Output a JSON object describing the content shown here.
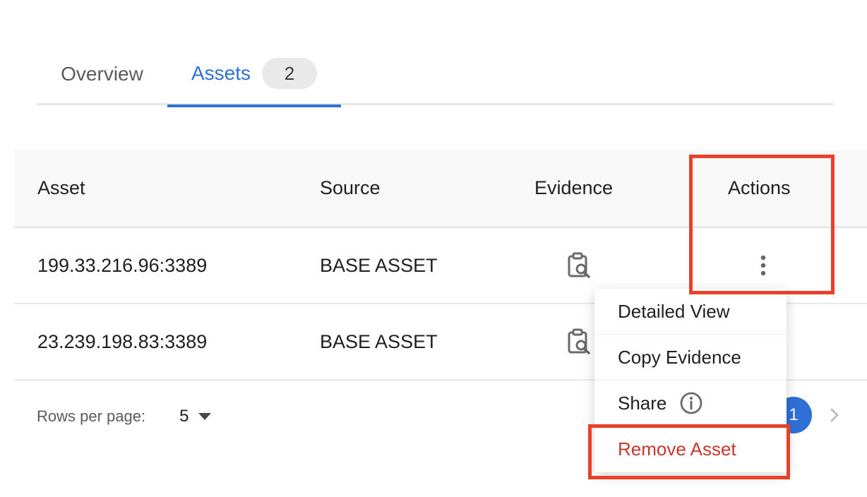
{
  "tabs": [
    {
      "label": "Overview"
    },
    {
      "label": "Assets",
      "count": "2"
    }
  ],
  "table": {
    "headers": {
      "asset": "Asset",
      "source": "Source",
      "evidence": "Evidence",
      "actions": "Actions"
    },
    "rows": [
      {
        "asset": "199.33.216.96:3389",
        "source": "BASE ASSET",
        "evidence_icon": "clipboard-search-icon",
        "actions_icon": "more-vertical-icon"
      },
      {
        "asset": "23.239.198.83:3389",
        "source": "BASE ASSET",
        "evidence_icon": "clipboard-search-icon"
      }
    ]
  },
  "pagination": {
    "rows_per_page_label": "Rows per page:",
    "rows_per_page_value": "5",
    "current_page": "1"
  },
  "context_menu": {
    "items": [
      {
        "label": "Detailed View"
      },
      {
        "label": "Copy Evidence"
      },
      {
        "label": "Share",
        "icon": "info-icon"
      },
      {
        "label": "Remove Asset",
        "color": "#c8372d"
      }
    ]
  },
  "colors": {
    "accent": "#2f6fd6",
    "highlight": "#e8412a",
    "danger": "#c8372d"
  }
}
